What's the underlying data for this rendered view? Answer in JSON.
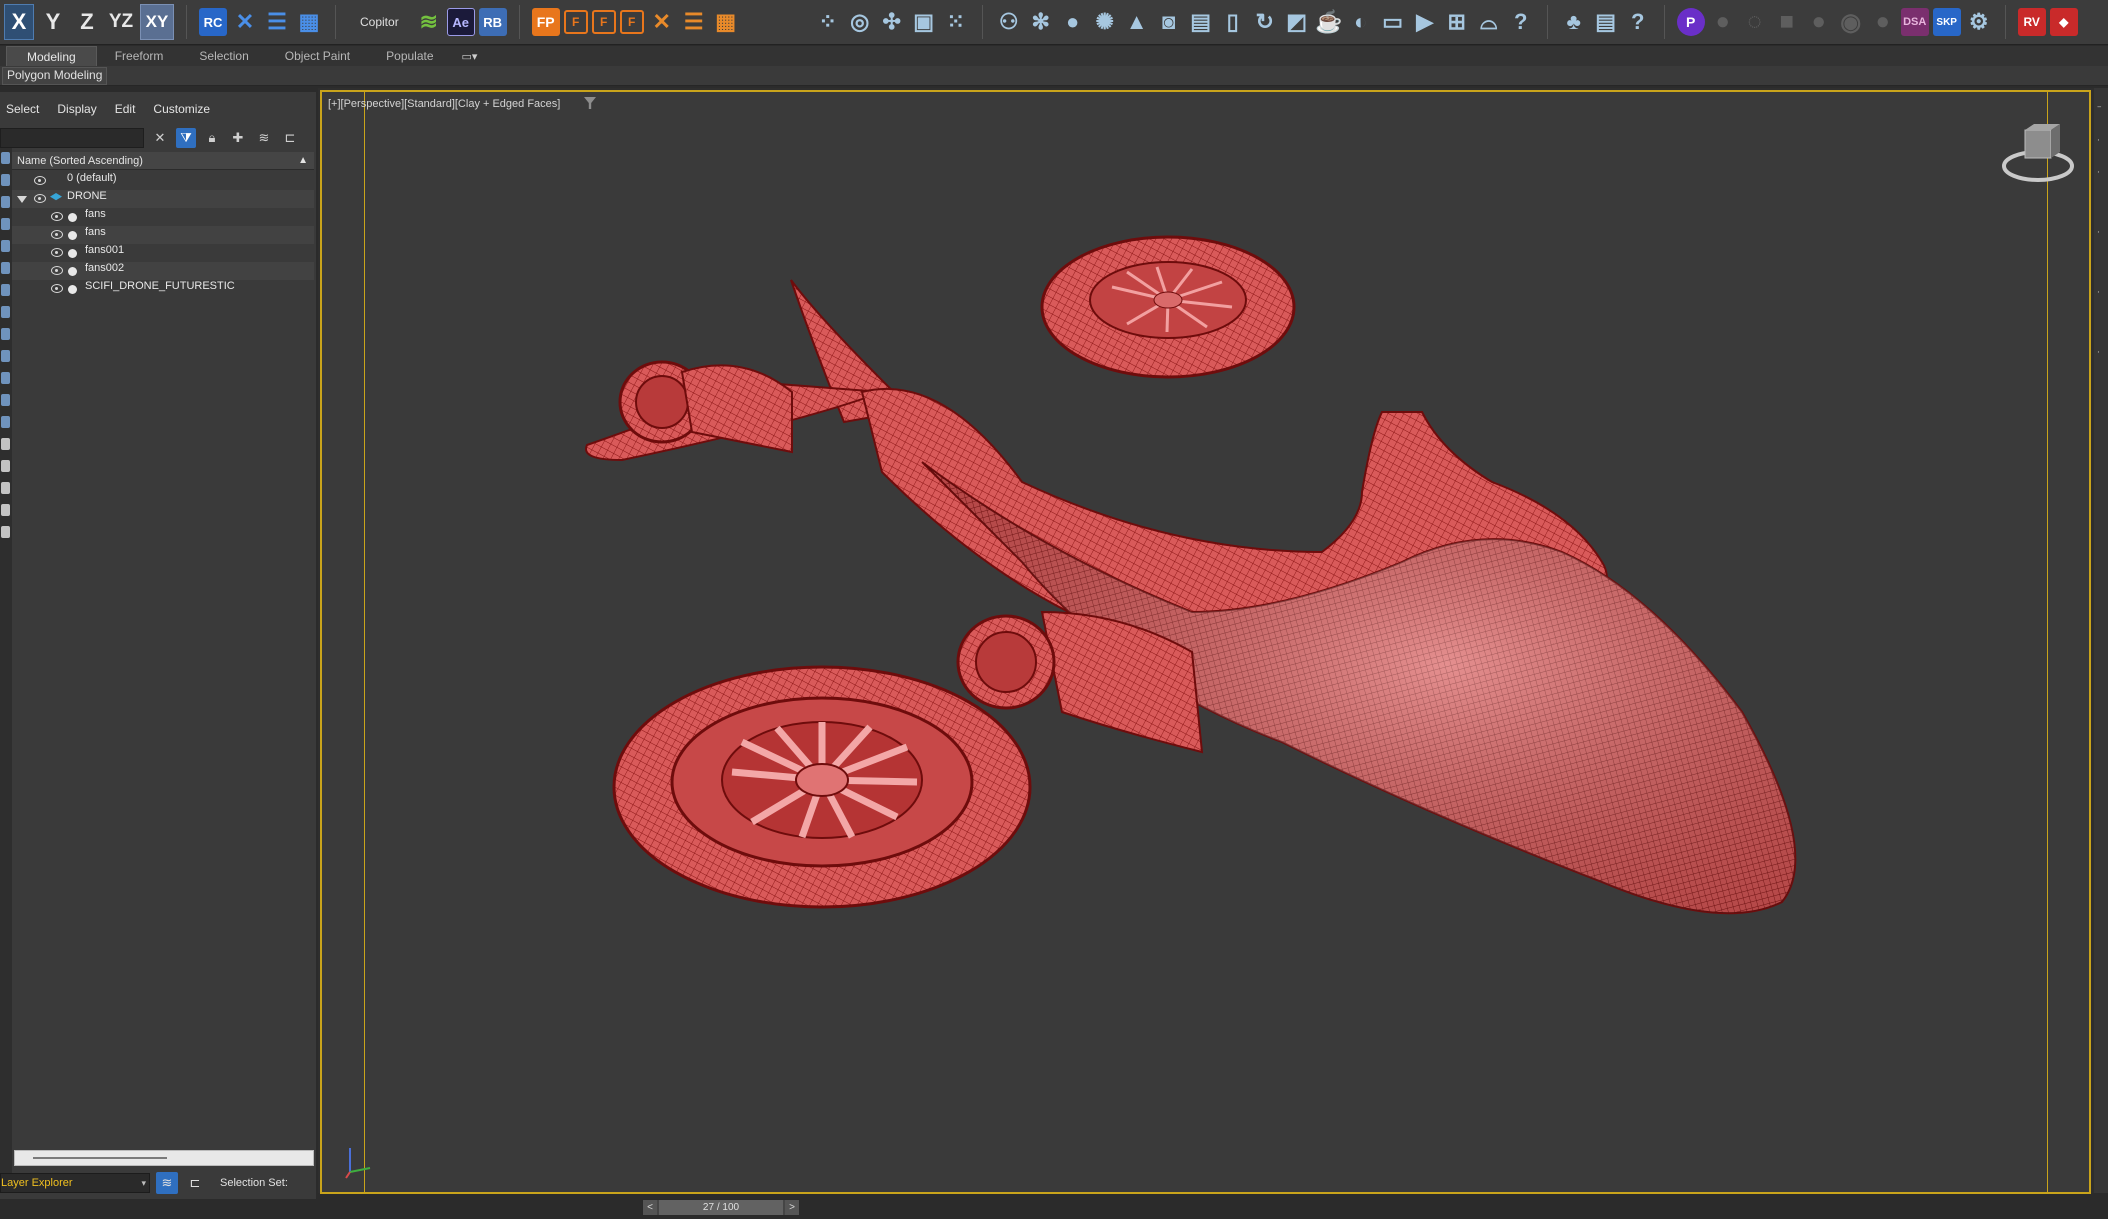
{
  "toolbar": {
    "axis_buttons": [
      "X",
      "Y",
      "Z",
      "YZ",
      "XY"
    ],
    "plugin_label": "Copitor",
    "tool_labels": {
      "rc": "RC",
      "ae": "Ae",
      "rb": "RB",
      "fp": "FP",
      "f1": "F",
      "f2": "F",
      "f3": "F",
      "dsa": "DSA",
      "skp": "SKP",
      "rv": "RV"
    }
  },
  "ribbon": {
    "tabs": [
      "Modeling",
      "Freeform",
      "Selection",
      "Object Paint",
      "Populate"
    ],
    "active_tab": "Modeling",
    "panel_label": "Polygon Modeling"
  },
  "scene_explorer": {
    "menu": [
      "Select",
      "Display",
      "Edit",
      "Customize"
    ],
    "column_header": "Name (Sorted Ascending)",
    "rows": [
      {
        "label": "0 (default)",
        "type": "layer",
        "depth": 0
      },
      {
        "label": "DRONE",
        "type": "layer",
        "depth": 0,
        "expanded": true
      },
      {
        "label": "fans",
        "type": "object",
        "depth": 1
      },
      {
        "label": "fans",
        "type": "object",
        "depth": 1
      },
      {
        "label": "fans001",
        "type": "object",
        "depth": 1
      },
      {
        "label": "fans002",
        "type": "object",
        "depth": 1
      },
      {
        "label": "SCIFI_DRONE_FUTURESTIC",
        "type": "object",
        "depth": 1
      }
    ],
    "footer": {
      "explorer_name": "Layer Explorer",
      "selection_set_label": "Selection Set:"
    }
  },
  "viewport": {
    "label": "[+][Perspective][Standard][Clay + Edged Faces]",
    "model_color": "#d95a5a",
    "wire_color": "#8b1414",
    "frame_color": "#c9a41b"
  },
  "time_slider": {
    "value": "27 / 100",
    "prev": "<",
    "next": ">"
  }
}
